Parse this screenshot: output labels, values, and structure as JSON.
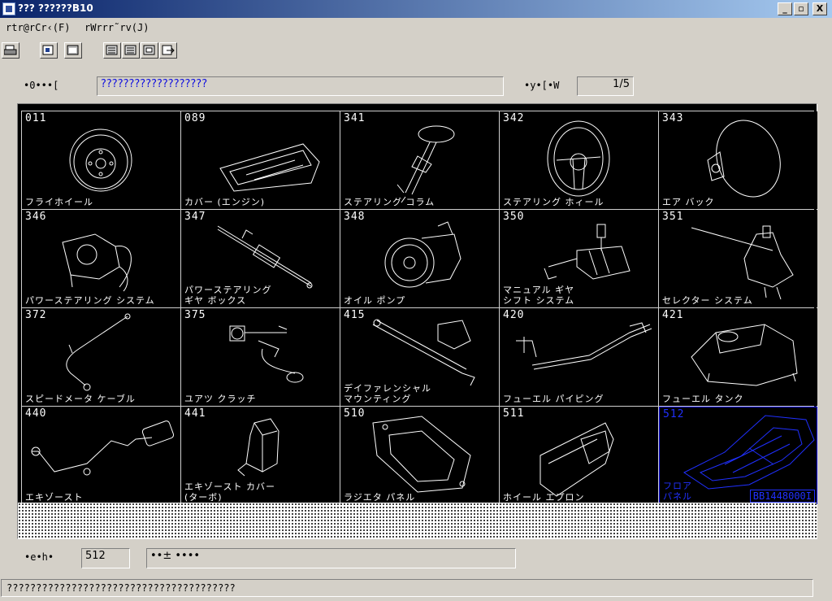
{
  "window": {
    "title": "??? ??????B10",
    "min_label": "_",
    "max_label": "▫",
    "close_label": "X"
  },
  "menu": [
    {
      "label": "rtr@rCr‹(F)"
    },
    {
      "label": "rWrrr˜rv(J)"
    }
  ],
  "toolbar": {
    "icons": [
      "print-icon",
      "select-icon",
      "window-icon",
      "page-first-icon",
      "page-prev-icon",
      "page-next-icon",
      "exit-icon"
    ]
  },
  "header": {
    "group_label": "•0•••[",
    "group_value": "???????????????????",
    "page_label": "•y•[•W",
    "page_value": "1/5"
  },
  "parts": [
    {
      "code": "011",
      "name": "フライホイール",
      "icon": "flywheel-icon"
    },
    {
      "code": "089",
      "name": "カバー (エンジン)",
      "icon": "engine-cover-icon"
    },
    {
      "code": "341",
      "name": "ステアリング コラム",
      "icon": "steering-column-icon"
    },
    {
      "code": "342",
      "name": "ステアリング ホィール",
      "icon": "steering-wheel-icon"
    },
    {
      "code": "343",
      "name": "エア バック",
      "icon": "airbag-icon"
    },
    {
      "code": "346",
      "name": "パワーステアリング システム",
      "icon": "power-steering-system-icon"
    },
    {
      "code": "347",
      "name": "パワーステアリング\nギヤ ボックス",
      "icon": "steering-gearbox-icon"
    },
    {
      "code": "348",
      "name": "オイル ポンプ",
      "icon": "oil-pump-icon"
    },
    {
      "code": "350",
      "name": "マニュアル ギヤ\nシフト システム",
      "icon": "gear-shift-icon"
    },
    {
      "code": "351",
      "name": "セレクター システム",
      "icon": "selector-icon"
    },
    {
      "code": "372",
      "name": "スピードメータ ケーブル",
      "icon": "speedometer-cable-icon"
    },
    {
      "code": "375",
      "name": "ユアツ クラッチ",
      "icon": "hydraulic-clutch-icon"
    },
    {
      "code": "415",
      "name": "デイファレンシャル\nマウンティング",
      "icon": "differential-mount-icon"
    },
    {
      "code": "420",
      "name": "フューエル パイピング",
      "icon": "fuel-piping-icon"
    },
    {
      "code": "421",
      "name": "フューエル タンク",
      "icon": "fuel-tank-icon"
    },
    {
      "code": "440",
      "name": "エキゾースト",
      "icon": "exhaust-icon"
    },
    {
      "code": "441",
      "name": "エキゾースト カバー\n(ターボ)",
      "icon": "exhaust-cover-icon"
    },
    {
      "code": "510",
      "name": "ラジエタ パネル",
      "icon": "radiator-panel-icon"
    },
    {
      "code": "511",
      "name": "ホイール エプロン",
      "icon": "wheel-apron-icon"
    },
    {
      "code": "512",
      "name": "フロア\nパネル",
      "icon": "floor-panel-icon",
      "selected": true,
      "part_number": "BB1448000I"
    }
  ],
  "footer": {
    "code_label": "•e•h•",
    "code_value": "512",
    "desc_value": "••± ••••"
  },
  "status": {
    "text": "???????????????????????????????????????"
  }
}
